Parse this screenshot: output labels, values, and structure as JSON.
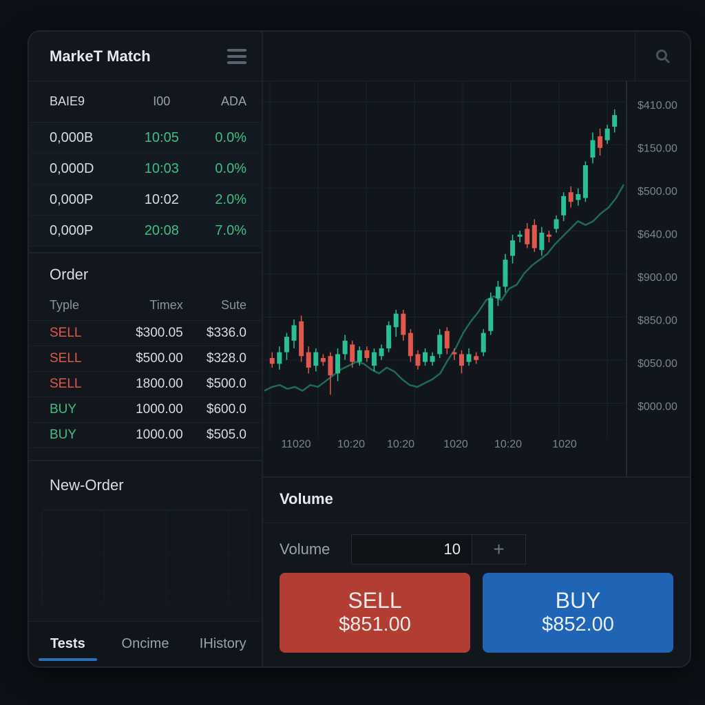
{
  "app": {
    "title": "MarkeT Match"
  },
  "market_table": {
    "headers": [
      "BAIE9",
      "I00",
      "ADA"
    ],
    "rows": [
      {
        "col1": "0,000B",
        "col2": "10:05",
        "col3": "0.0%"
      },
      {
        "col1": "0,000D",
        "col2": "10:03",
        "col3": "0.0%"
      },
      {
        "col1": "0,000P",
        "col2": "10:02",
        "col3": "2.0%"
      },
      {
        "col1": "0,000P",
        "col2": "20:08",
        "col3": "7.0%"
      }
    ]
  },
  "order_book": {
    "title": "Order",
    "headers": [
      "Typle",
      "Timex",
      "Sute"
    ],
    "rows": [
      {
        "type": "SELL",
        "time": "$300.05",
        "size": "$336.0"
      },
      {
        "type": "SELL",
        "time": "$500.00",
        "size": "$328.0"
      },
      {
        "type": "SELL",
        "time": "1800.00",
        "size": "$500.0"
      },
      {
        "type": "BUY",
        "time": "1000.00",
        "size": "$600.0"
      },
      {
        "type": "BUY",
        "time": "1000.00",
        "size": "$505.0"
      }
    ]
  },
  "new_order": {
    "title": "New-Order"
  },
  "tabs": [
    {
      "label": "Tests",
      "active": true
    },
    {
      "label": "Oncime",
      "active": false
    },
    {
      "label": "IHistory",
      "active": false
    }
  ],
  "chart_data": {
    "type": "candlestick",
    "y_ticks": [
      "$410.00",
      "$150.00",
      "$500.00",
      "$640.00",
      "$900.00",
      "$850.00",
      "$050.00",
      "$000.00"
    ],
    "x_ticks": [
      "11020",
      "10:20",
      "10:20",
      "1020",
      "10:20",
      "1020"
    ],
    "candles": [
      {
        "o": 35,
        "c": 32,
        "h": 38,
        "l": 30
      },
      {
        "o": 32,
        "c": 38,
        "h": 41,
        "l": 29
      },
      {
        "o": 38,
        "c": 46,
        "h": 48,
        "l": 34
      },
      {
        "o": 44,
        "c": 52,
        "h": 55,
        "l": 40
      },
      {
        "o": 54,
        "c": 36,
        "h": 57,
        "l": 33
      },
      {
        "o": 38,
        "c": 30,
        "h": 41,
        "l": 27
      },
      {
        "o": 31,
        "c": 38,
        "h": 40,
        "l": 28
      },
      {
        "o": 35,
        "c": 33,
        "h": 37,
        "l": 31
      },
      {
        "o": 36,
        "c": 26,
        "h": 38,
        "l": 16
      },
      {
        "o": 27,
        "c": 37,
        "h": 40,
        "l": 23
      },
      {
        "o": 37,
        "c": 44,
        "h": 47,
        "l": 34
      },
      {
        "o": 42,
        "c": 33,
        "h": 44,
        "l": 30
      },
      {
        "o": 33,
        "c": 39,
        "h": 41,
        "l": 31
      },
      {
        "o": 39,
        "c": 35,
        "h": 41,
        "l": 33
      },
      {
        "o": 31,
        "c": 38,
        "h": 40,
        "l": 28
      },
      {
        "o": 36,
        "c": 40,
        "h": 42,
        "l": 34
      },
      {
        "o": 40,
        "c": 52,
        "h": 54,
        "l": 38
      },
      {
        "o": 51,
        "c": 58,
        "h": 60,
        "l": 46
      },
      {
        "o": 58,
        "c": 47,
        "h": 60,
        "l": 44
      },
      {
        "o": 48,
        "c": 36,
        "h": 50,
        "l": 33
      },
      {
        "o": 37,
        "c": 31,
        "h": 39,
        "l": 29
      },
      {
        "o": 33,
        "c": 38,
        "h": 40,
        "l": 31
      },
      {
        "o": 33,
        "c": 36,
        "h": 38,
        "l": 31
      },
      {
        "o": 37,
        "c": 47,
        "h": 50,
        "l": 35
      },
      {
        "o": 49,
        "c": 40,
        "h": 51,
        "l": 37
      },
      {
        "o": 38,
        "c": 37,
        "h": 40,
        "l": 34
      },
      {
        "o": 37,
        "c": 31,
        "h": 39,
        "l": 27
      },
      {
        "o": 33,
        "c": 37,
        "h": 40,
        "l": 31
      },
      {
        "o": 36,
        "c": 34,
        "h": 38,
        "l": 32
      },
      {
        "o": 38,
        "c": 48,
        "h": 50,
        "l": 36
      },
      {
        "o": 49,
        "c": 66,
        "h": 69,
        "l": 47
      },
      {
        "o": 66,
        "c": 72,
        "h": 75,
        "l": 62
      },
      {
        "o": 72,
        "c": 86,
        "h": 89,
        "l": 69
      },
      {
        "o": 88,
        "c": 96,
        "h": 99,
        "l": 84
      },
      {
        "o": 99,
        "c": 99,
        "h": 101,
        "l": 95
      },
      {
        "o": 102,
        "c": 94,
        "h": 105,
        "l": 92
      },
      {
        "o": 104,
        "c": 92,
        "h": 107,
        "l": 90
      },
      {
        "o": 91,
        "c": 100,
        "h": 103,
        "l": 88
      },
      {
        "o": 99,
        "c": 98,
        "h": 101,
        "l": 95
      },
      {
        "o": 102,
        "c": 107,
        "h": 109,
        "l": 100
      },
      {
        "o": 109,
        "c": 119,
        "h": 121,
        "l": 106
      },
      {
        "o": 121,
        "c": 116,
        "h": 124,
        "l": 113
      },
      {
        "o": 117,
        "c": 120,
        "h": 123,
        "l": 114
      },
      {
        "o": 118,
        "c": 135,
        "h": 137,
        "l": 116
      },
      {
        "o": 139,
        "c": 148,
        "h": 152,
        "l": 136
      },
      {
        "o": 150,
        "c": 144,
        "h": 154,
        "l": 140
      },
      {
        "o": 148,
        "c": 154,
        "h": 156,
        "l": 146
      },
      {
        "o": 155,
        "c": 161,
        "h": 164,
        "l": 152
      }
    ],
    "line": [
      18,
      20,
      21,
      19,
      20,
      18,
      21,
      20,
      23,
      26,
      29,
      31,
      33,
      32,
      29,
      27,
      30,
      28,
      24,
      21,
      20,
      22,
      24,
      27,
      34,
      40,
      48,
      54,
      59,
      65,
      67,
      65,
      71,
      73,
      79,
      83,
      86,
      89,
      94,
      98,
      102,
      106,
      104,
      106,
      110,
      113,
      118,
      125
    ]
  },
  "volume_panel": {
    "title": "Volume",
    "field_label": "Volume",
    "field_value": "10",
    "plus": "+",
    "sell": {
      "label": "SELL",
      "price": "$851.00"
    },
    "buy": {
      "label": "BUY",
      "price": "$852.00"
    }
  },
  "colors": {
    "up": "#2bbf98",
    "down": "#e0574c",
    "line": "#1f6b56",
    "grid": "#1b2129"
  }
}
